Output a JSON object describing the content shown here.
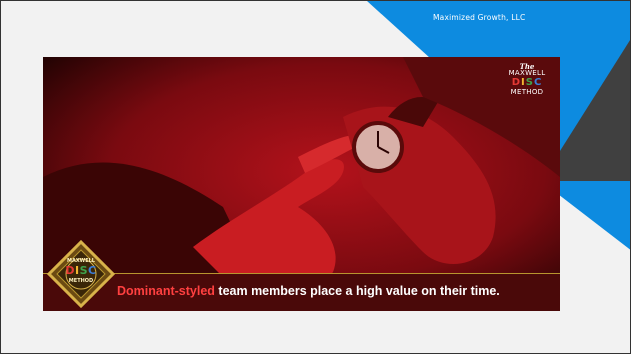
{
  "slide": {
    "company": "Maximized Growth, LLC"
  },
  "brand": {
    "the": "The",
    "maxwell": "MAXWELL",
    "disc_letters": [
      "D",
      "I",
      "S",
      "C"
    ],
    "method": "METHOD"
  },
  "badge": {
    "maxwell": "MAXWELL",
    "disc_letters": [
      "D",
      "I",
      "S",
      "C"
    ],
    "method": "METHOD"
  },
  "caption": {
    "highlight": "Dominant-styled",
    "rest": " team members place a high value on their time."
  },
  "colors": {
    "accent_blue": "#0d8be0",
    "dark_gray": "#404040",
    "photo_red": "#b3121b",
    "caption_bg": "#4a0909",
    "gold": "#b8952e",
    "disc_d": "#e53935",
    "disc_i": "#f2b632",
    "disc_s": "#3fa34d",
    "disc_c": "#3b7dd8"
  },
  "image": {
    "subject": "hand-pointing-at-wristwatch-photo"
  }
}
